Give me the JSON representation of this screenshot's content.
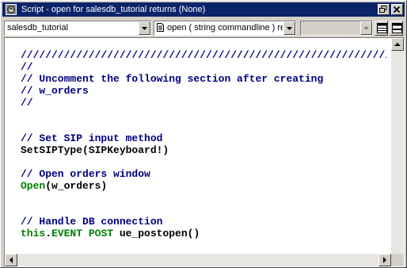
{
  "window": {
    "title": "Script - open for salesdb_tutorial returns (None)"
  },
  "toolbar": {
    "object_combo_value": "salesdb_tutorial",
    "event_combo_value": "open ( string commandline ) re",
    "third_combo_value": ""
  },
  "editor": {
    "lines": [
      [
        {
          "t": "////////////////////////////////////////////////////////////",
          "c": "comment"
        }
      ],
      [
        {
          "t": "//",
          "c": "comment"
        }
      ],
      [
        {
          "t": "// Uncomment the following section after creating",
          "c": "comment"
        }
      ],
      [
        {
          "t": "// w_orders",
          "c": "comment"
        }
      ],
      [
        {
          "t": "//",
          "c": "comment"
        }
      ],
      [],
      [],
      [
        {
          "t": "// Set SIP input method",
          "c": "comment"
        }
      ],
      [
        {
          "t": "SetSIPType(SIPKeyboard!)",
          "c": "plain"
        }
      ],
      [],
      [
        {
          "t": "// Open orders window",
          "c": "comment"
        }
      ],
      [
        {
          "t": "Open",
          "c": "kw"
        },
        {
          "t": "(w_orders)",
          "c": "plain"
        }
      ],
      [],
      [],
      [
        {
          "t": "// Handle DB connection",
          "c": "comment"
        }
      ],
      [
        {
          "t": "this",
          "c": "kw"
        },
        {
          "t": ".",
          "c": "plain"
        },
        {
          "t": "EVENT POST",
          "c": "kw"
        },
        {
          "t": " ue_postopen()",
          "c": "plain"
        }
      ]
    ]
  },
  "colors": {
    "titlebar": "#0a246a",
    "comment": "#000080",
    "keyword": "#008000",
    "plain": "#000000"
  },
  "icons": {
    "app": "script-window-icon",
    "restore": "restore-icon",
    "maximize": "maximize-icon",
    "close": "close-icon",
    "event_list": "event-script-icon"
  }
}
